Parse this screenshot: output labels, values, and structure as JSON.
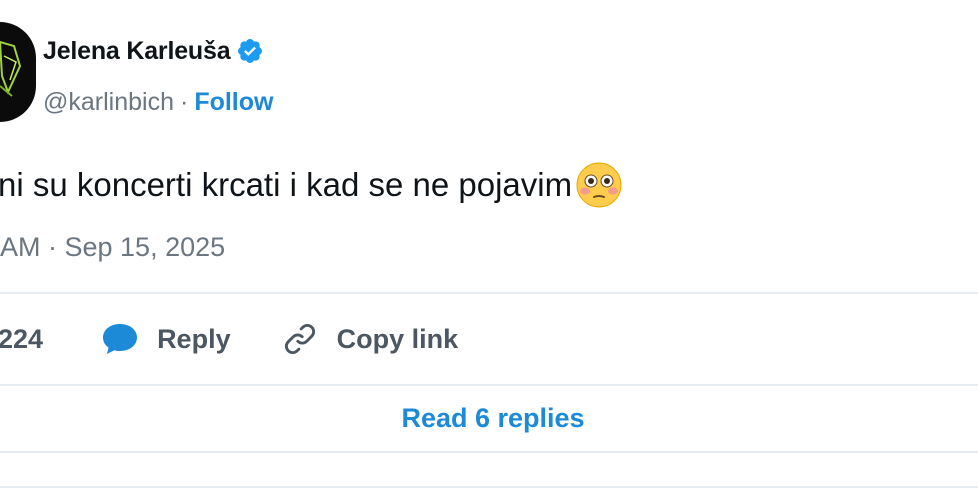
{
  "author": {
    "name": "Jelena Karleuša",
    "handle": "@karlinbich",
    "separator": "·",
    "follow_label": "Follow",
    "verified_color": "#1d9bf0",
    "avatar_icon": "avatar-photo"
  },
  "tweet": {
    "text": "ni su koncerti krcati i kad se ne pojavim",
    "emoji": "flushed-face",
    "timestamp": "AM · Sep 15, 2025"
  },
  "actions": {
    "like_count": "224",
    "reply_label": "Reply",
    "copy_link_label": "Copy link"
  },
  "footer": {
    "read_replies_label": "Read 6 replies"
  },
  "colors": {
    "accent": "#1d8ad8",
    "muted": "#6b7680",
    "divider": "#e6ecf0"
  }
}
